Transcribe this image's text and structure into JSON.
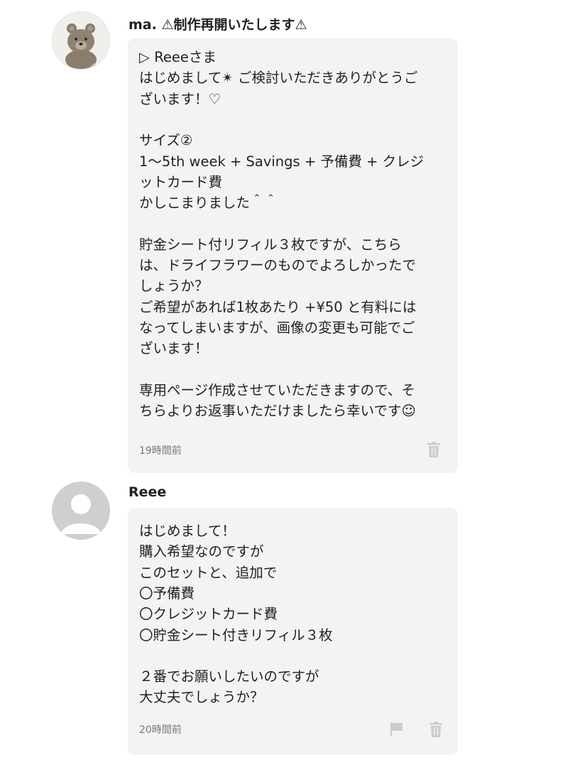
{
  "comments": [
    {
      "author": "ma. ⚠制作再開いたします⚠",
      "avatar_icon": "bear-avatar",
      "lines": [
        "▷ Reeeさま",
        "はじめまして✴︎ ご検討いただきありがとうご",
        "ざいます！♡",
        "",
        "サイズ②",
        "1〜5th week + Savings + 予備費 + クレジ",
        "ットカード費",
        "かしこまりました＾＾",
        "",
        "貯金シート付リフィル３枚ですが、こちら",
        "は、ドライフラワーのものでよろしかったで",
        "しょうか？",
        "ご希望があれば1枚あたり +¥50 と有料には",
        "なってしまいますが、画像の変更も可能でご",
        "ざいます！",
        "",
        "専用ページ作成させていただきますので、そ",
        "ちらよりお返事いただけましたら幸いです☺︎"
      ],
      "time": "19時間前",
      "actions": [
        "trash-icon"
      ]
    },
    {
      "author": "Reee",
      "avatar_icon": "default-user-avatar",
      "lines": [
        "はじめまして！",
        "購入希望なのですが",
        "このセットと、追加で",
        "〇予備費",
        "〇クレジットカード費",
        "〇貯金シート付きリフィル３枚",
        "",
        "２番でお願いしたいのですが",
        "大丈夫でしょうか？"
      ],
      "time": "20時間前",
      "actions": [
        "flag-icon",
        "trash-icon"
      ]
    }
  ],
  "colors": {
    "bubble": "#f3f3f3",
    "text": "#222222",
    "meta": "#777777",
    "icon": "#cccccc"
  }
}
